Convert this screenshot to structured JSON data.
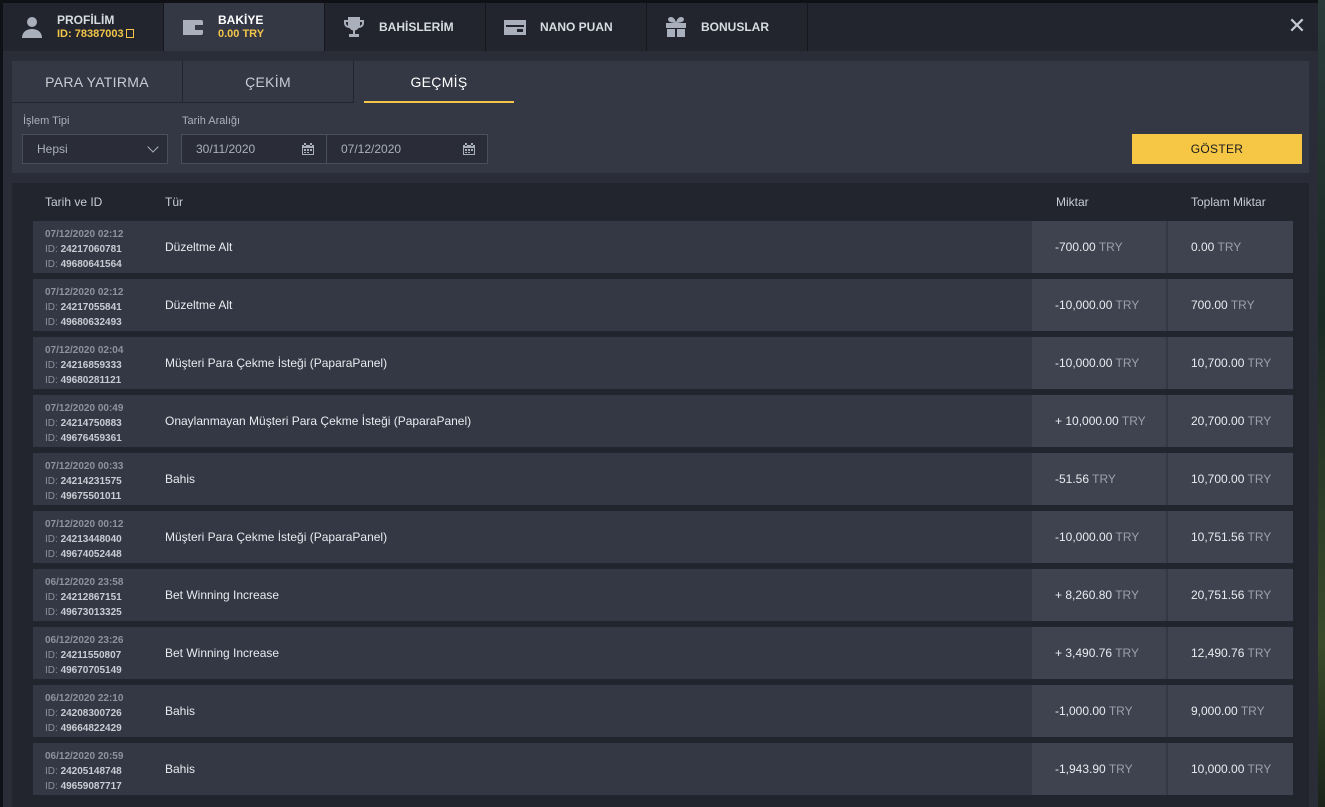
{
  "top_tabs": [
    {
      "label": "PROFİLİM",
      "sub": "ID: 78387003",
      "icon": "user-icon"
    },
    {
      "label": "BAKİYE",
      "sub": "0.00 TRY",
      "icon": "wallet-icon"
    },
    {
      "label": "BAHİSLERİM",
      "sub": "",
      "icon": "trophy-icon"
    },
    {
      "label": "NANO PUAN",
      "sub": "",
      "icon": "card-icon"
    },
    {
      "label": "BONUSLAR",
      "sub": "",
      "icon": "gift-icon"
    }
  ],
  "close_label": "✕",
  "sub_tabs": [
    {
      "label": "PARA YATIRMA"
    },
    {
      "label": "ÇEKİM"
    },
    {
      "label": "GEÇMİŞ"
    }
  ],
  "filters": {
    "type_label": "İşlem Tipi",
    "type_value": "Hepsi",
    "date_label": "Tarih Aralığı",
    "date_from": "30/11/2020",
    "date_to": "07/12/2020",
    "show_button": "GÖSTER"
  },
  "table": {
    "headers": {
      "date": "Tarih ve ID",
      "type": "Tür",
      "amount": "Miktar",
      "total": "Toplam Miktar"
    },
    "id_prefix": "ID:",
    "currency": "TRY",
    "rows": [
      {
        "date": "07/12/2020 02:12",
        "id1": "24217060781",
        "id2": "49680641564",
        "type": "Düzeltme Alt",
        "amount": "-700.00",
        "total": "0.00"
      },
      {
        "date": "07/12/2020 02:12",
        "id1": "24217055841",
        "id2": "49680632493",
        "type": "Düzeltme Alt",
        "amount": "-10,000.00",
        "total": "700.00"
      },
      {
        "date": "07/12/2020 02:04",
        "id1": "24216859333",
        "id2": "49680281121",
        "type": "Müşteri Para Çekme İsteği (PaparaPanel)",
        "amount": "-10,000.00",
        "total": "10,700.00"
      },
      {
        "date": "07/12/2020 00:49",
        "id1": "24214750883",
        "id2": "49676459361",
        "type": "Onaylanmayan Müşteri Para Çekme İsteği (PaparaPanel)",
        "amount": "+ 10,000.00",
        "total": "20,700.00"
      },
      {
        "date": "07/12/2020 00:33",
        "id1": "24214231575",
        "id2": "49675501011",
        "type": "Bahis",
        "amount": "-51.56",
        "total": "10,700.00"
      },
      {
        "date": "07/12/2020 00:12",
        "id1": "24213448040",
        "id2": "49674052448",
        "type": "Müşteri Para Çekme İsteği (PaparaPanel)",
        "amount": "-10,000.00",
        "total": "10,751.56"
      },
      {
        "date": "06/12/2020 23:58",
        "id1": "24212867151",
        "id2": "49673013325",
        "type": "Bet Winning Increase",
        "amount": "+ 8,260.80",
        "total": "20,751.56"
      },
      {
        "date": "06/12/2020 23:26",
        "id1": "24211550807",
        "id2": "49670705149",
        "type": "Bet Winning Increase",
        "amount": "+ 3,490.76",
        "total": "12,490.76"
      },
      {
        "date": "06/12/2020 22:10",
        "id1": "24208300726",
        "id2": "49664822429",
        "type": "Bahis",
        "amount": "-1,000.00",
        "total": "9,000.00"
      },
      {
        "date": "06/12/2020 20:59",
        "id1": "24205148748",
        "id2": "49659087717",
        "type": "Bahis",
        "amount": "-1,943.90",
        "total": "10,000.00"
      }
    ]
  }
}
